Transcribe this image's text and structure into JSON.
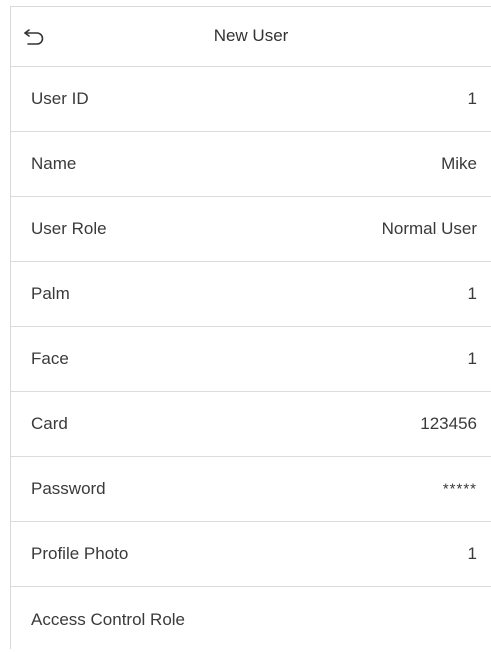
{
  "header": {
    "title": "New User",
    "back_icon": "back-arrow-icon"
  },
  "rows": [
    {
      "label": "User ID",
      "value": "1"
    },
    {
      "label": "Name",
      "value": "Mike"
    },
    {
      "label": "User Role",
      "value": "Normal User"
    },
    {
      "label": "Palm",
      "value": "1"
    },
    {
      "label": "Face",
      "value": "1"
    },
    {
      "label": "Card",
      "value": "123456"
    },
    {
      "label": "Password",
      "value": "*****"
    },
    {
      "label": "Profile Photo",
      "value": "1"
    },
    {
      "label": "Access Control Role",
      "value": ""
    }
  ]
}
